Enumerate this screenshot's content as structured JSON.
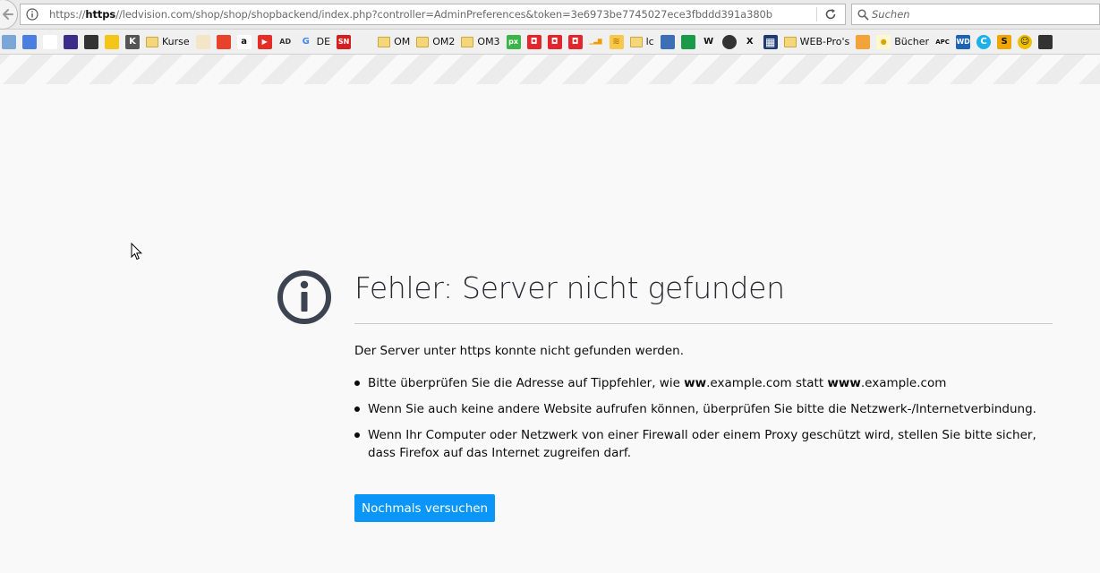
{
  "navigation": {
    "url_prefix": "https://",
    "url_host": "https",
    "url_rest": "//ledvision.com/shop/shop/shopbackend/index.php?controller=AdminPreferences&token=3e6973be7745027ece3fbddd391a380b",
    "search_placeholder": "Suchen",
    "icons": [
      "back-arrow-icon",
      "info-icon",
      "reload-icon",
      "search-icon"
    ]
  },
  "bookmarks": {
    "items": [
      {
        "label": "",
        "icon": "bookmark-icon"
      },
      {
        "label": "",
        "icon": "translate-icon"
      },
      {
        "label": "",
        "icon": "gmail-icon"
      },
      {
        "label": "",
        "icon": "mail-icon"
      },
      {
        "label": "",
        "icon": "feather-icon"
      },
      {
        "label": "",
        "icon": "hexagon-icon"
      },
      {
        "label": "",
        "icon": "k-icon",
        "glyph": "K"
      },
      {
        "label": "Kurse",
        "icon": "folder-icon"
      },
      {
        "label": "",
        "icon": "spiral-icon"
      },
      {
        "label": "",
        "icon": "adobe-icon"
      },
      {
        "label": "",
        "icon": "amazon-icon",
        "glyph": "a"
      },
      {
        "label": "",
        "icon": "youtube-icon"
      },
      {
        "label": "",
        "icon": "ad-icon",
        "glyph": "AD"
      },
      {
        "label": "DE",
        "icon": "google-icon",
        "glyph": "G"
      },
      {
        "label": "",
        "icon": "sn-icon",
        "glyph": "SN"
      },
      {
        "label": "",
        "icon": "adwords-icon"
      },
      {
        "label": "OM",
        "icon": "folder-icon"
      },
      {
        "label": "OM2",
        "icon": "folder-icon"
      },
      {
        "label": "OM3",
        "icon": "folder-icon"
      },
      {
        "label": "",
        "icon": "px-icon",
        "glyph": "px"
      },
      {
        "label": "",
        "icon": "red-square-icon"
      },
      {
        "label": "",
        "icon": "red-square-icon"
      },
      {
        "label": "",
        "icon": "red-square-icon"
      },
      {
        "label": "",
        "icon": "bar-chart-icon"
      },
      {
        "label": "",
        "icon": "rss-icon"
      },
      {
        "label": "lc",
        "icon": "folder-icon"
      },
      {
        "label": "",
        "icon": "blue-square-icon"
      },
      {
        "label": "",
        "icon": "green-oval-icon"
      },
      {
        "label": "",
        "icon": "w-icon",
        "glyph": "W"
      },
      {
        "label": "",
        "icon": "circle-logo-icon"
      },
      {
        "label": "",
        "icon": "x-icon",
        "glyph": "X"
      },
      {
        "label": "",
        "icon": "grid-icon"
      },
      {
        "label": "WEB-Pro's",
        "icon": "folder-icon"
      },
      {
        "label": "",
        "icon": "layers-icon"
      },
      {
        "label": "Bücher",
        "icon": "bulb-icon"
      },
      {
        "label": "",
        "icon": "apc-icon",
        "glyph": "APC"
      },
      {
        "label": "",
        "icon": "wd-icon",
        "glyph": "WD"
      },
      {
        "label": "",
        "icon": "c-icon",
        "glyph": "C"
      },
      {
        "label": "",
        "icon": "s-icon",
        "glyph": "S"
      },
      {
        "label": "",
        "icon": "smiley-icon"
      },
      {
        "label": "",
        "icon": "ninja-icon"
      }
    ]
  },
  "error": {
    "title": "Fehler: Server nicht gefunden",
    "description": "Der Server unter https konnte nicht gefunden werden.",
    "bullets": [
      {
        "parts": [
          {
            "text": "Bitte überprüfen Sie die Adresse auf Tippfehler, wie ",
            "bold": false
          },
          {
            "text": "ww",
            "bold": true
          },
          {
            "text": ".example.com statt ",
            "bold": false
          },
          {
            "text": "www",
            "bold": true
          },
          {
            "text": ".example.com",
            "bold": false
          }
        ]
      },
      {
        "parts": [
          {
            "text": "Wenn Sie auch keine andere Website aufrufen können, überprüfen Sie bitte die Netzwerk-/Internetverbindung.",
            "bold": false
          }
        ]
      },
      {
        "parts": [
          {
            "text": "Wenn Ihr Computer oder Netzwerk von einer Firewall oder einem Proxy geschützt wird, stellen Sie bitte sicher, dass Firefox auf das Internet zugreifen darf.",
            "bold": false
          }
        ]
      }
    ],
    "retry_label": "Nochmals versuchen"
  },
  "colors": {
    "page_background": "#f9f9fa",
    "button_blue": "#0996f8",
    "title_color": "#2a2a2e",
    "icon_dark": "#3d4451"
  }
}
